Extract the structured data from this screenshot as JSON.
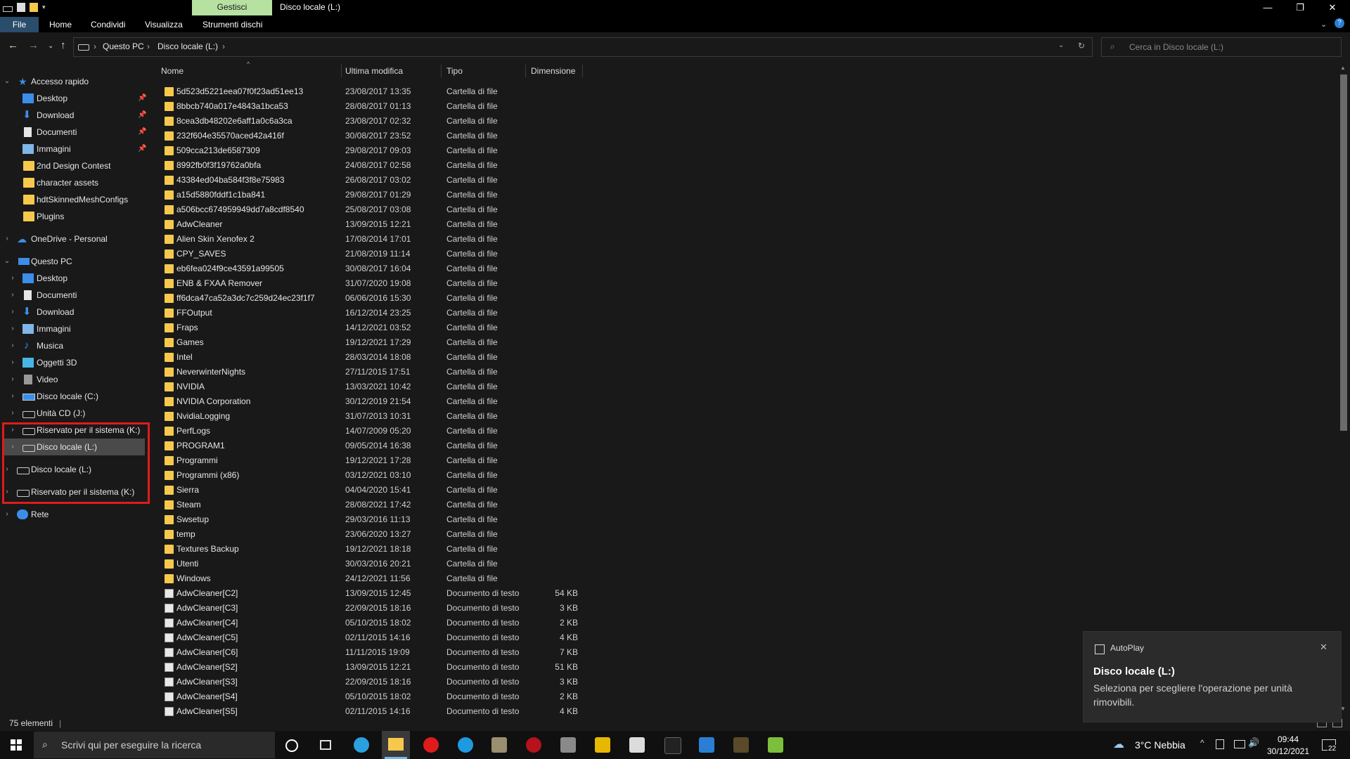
{
  "window": {
    "context_tab": "Gestisci",
    "title": "Disco locale (L:)",
    "minimize": "—",
    "maximize": "❐",
    "close": "✕"
  },
  "ribbon": {
    "tabs": [
      "File",
      "Home",
      "Condividi",
      "Visualizza",
      "Strumenti dischi"
    ]
  },
  "address": {
    "crumbs": [
      "Questo PC",
      "Disco locale (L:)"
    ],
    "search_placeholder": "Cerca in Disco locale (L:)"
  },
  "sidebar": {
    "quick_access": "Accesso rapido",
    "quick_items": [
      {
        "label": "Desktop",
        "icon": "desktop-icon",
        "pinned": true
      },
      {
        "label": "Download",
        "icon": "download-icon",
        "pinned": true
      },
      {
        "label": "Documenti",
        "icon": "documents-icon",
        "pinned": true
      },
      {
        "label": "Immagini",
        "icon": "pictures-icon",
        "pinned": true
      },
      {
        "label": "2nd Design Contest",
        "icon": "folder-icon",
        "pinned": false
      },
      {
        "label": "character assets",
        "icon": "folder-icon",
        "pinned": false
      },
      {
        "label": "hdtSkinnedMeshConfigs",
        "icon": "folder-icon",
        "pinned": false
      },
      {
        "label": "Plugins",
        "icon": "folder-icon",
        "pinned": false
      }
    ],
    "onedrive": "OneDrive - Personal",
    "this_pc": "Questo PC",
    "pc_items": [
      {
        "label": "Desktop",
        "icon": "desktop-icon"
      },
      {
        "label": "Documenti",
        "icon": "documents-icon"
      },
      {
        "label": "Download",
        "icon": "download-icon"
      },
      {
        "label": "Immagini",
        "icon": "pictures-icon"
      },
      {
        "label": "Musica",
        "icon": "music-icon"
      },
      {
        "label": "Oggetti 3D",
        "icon": "objects-3d-icon"
      },
      {
        "label": "Video",
        "icon": "video-icon"
      },
      {
        "label": "Disco locale (C:)",
        "icon": "drive-icon"
      },
      {
        "label": "Unità CD (J:)",
        "icon": "cd-drive-icon"
      },
      {
        "label": "Riservato per il sistema (K:)",
        "icon": "drive-icon"
      },
      {
        "label": "Disco locale (L:)",
        "icon": "drive-icon"
      }
    ],
    "root_drives": [
      {
        "label": "Disco locale (L:)",
        "icon": "drive-icon"
      },
      {
        "label": "Riservato per il sistema (K:)",
        "icon": "drive-icon"
      }
    ],
    "network": "Rete"
  },
  "columns": [
    "Nome",
    "Ultima modifica",
    "Tipo",
    "Dimensione"
  ],
  "files": [
    {
      "name": "5d523d5221eea07f0f23ad51ee13",
      "date": "23/08/2017 13:35",
      "type": "Cartella di file",
      "size": "",
      "kind": "folder"
    },
    {
      "name": "8bbcb740a017e4843a1bca53",
      "date": "28/08/2017 01:13",
      "type": "Cartella di file",
      "size": "",
      "kind": "folder"
    },
    {
      "name": "8cea3db48202e6aff1a0c6a3ca",
      "date": "23/08/2017 02:32",
      "type": "Cartella di file",
      "size": "",
      "kind": "folder"
    },
    {
      "name": "232f604e35570aced42a416f",
      "date": "30/08/2017 23:52",
      "type": "Cartella di file",
      "size": "",
      "kind": "folder"
    },
    {
      "name": "509cca213de6587309",
      "date": "29/08/2017 09:03",
      "type": "Cartella di file",
      "size": "",
      "kind": "folder"
    },
    {
      "name": "8992fb0f3f19762a0bfa",
      "date": "24/08/2017 02:58",
      "type": "Cartella di file",
      "size": "",
      "kind": "folder"
    },
    {
      "name": "43384ed04ba584f3f8e75983",
      "date": "26/08/2017 03:02",
      "type": "Cartella di file",
      "size": "",
      "kind": "folder"
    },
    {
      "name": "a15d5880fddf1c1ba841",
      "date": "29/08/2017 01:29",
      "type": "Cartella di file",
      "size": "",
      "kind": "folder"
    },
    {
      "name": "a506bcc674959949dd7a8cdf8540",
      "date": "25/08/2017 03:08",
      "type": "Cartella di file",
      "size": "",
      "kind": "folder"
    },
    {
      "name": "AdwCleaner",
      "date": "13/09/2015 12:21",
      "type": "Cartella di file",
      "size": "",
      "kind": "folder"
    },
    {
      "name": "Alien Skin Xenofex 2",
      "date": "17/08/2014 17:01",
      "type": "Cartella di file",
      "size": "",
      "kind": "folder"
    },
    {
      "name": "CPY_SAVES",
      "date": "21/08/2019 11:14",
      "type": "Cartella di file",
      "size": "",
      "kind": "folder"
    },
    {
      "name": "eb6fea024f9ce43591a99505",
      "date": "30/08/2017 16:04",
      "type": "Cartella di file",
      "size": "",
      "kind": "folder"
    },
    {
      "name": "ENB & FXAA Remover",
      "date": "31/07/2020 19:08",
      "type": "Cartella di file",
      "size": "",
      "kind": "folder"
    },
    {
      "name": "ff6dca47ca52a3dc7c259d24ec23f1f7",
      "date": "06/06/2016 15:30",
      "type": "Cartella di file",
      "size": "",
      "kind": "folder"
    },
    {
      "name": "FFOutput",
      "date": "16/12/2014 23:25",
      "type": "Cartella di file",
      "size": "",
      "kind": "folder"
    },
    {
      "name": "Fraps",
      "date": "14/12/2021 03:52",
      "type": "Cartella di file",
      "size": "",
      "kind": "folder"
    },
    {
      "name": "Games",
      "date": "19/12/2021 17:29",
      "type": "Cartella di file",
      "size": "",
      "kind": "folder"
    },
    {
      "name": "Intel",
      "date": "28/03/2014 18:08",
      "type": "Cartella di file",
      "size": "",
      "kind": "folder"
    },
    {
      "name": "NeverwinterNights",
      "date": "27/11/2015 17:51",
      "type": "Cartella di file",
      "size": "",
      "kind": "folder"
    },
    {
      "name": "NVIDIA",
      "date": "13/03/2021 10:42",
      "type": "Cartella di file",
      "size": "",
      "kind": "folder"
    },
    {
      "name": "NVIDIA Corporation",
      "date": "30/12/2019 21:54",
      "type": "Cartella di file",
      "size": "",
      "kind": "folder"
    },
    {
      "name": "NvidiaLogging",
      "date": "31/07/2013 10:31",
      "type": "Cartella di file",
      "size": "",
      "kind": "folder"
    },
    {
      "name": "PerfLogs",
      "date": "14/07/2009 05:20",
      "type": "Cartella di file",
      "size": "",
      "kind": "folder"
    },
    {
      "name": "PROGRAM1",
      "date": "09/05/2014 16:38",
      "type": "Cartella di file",
      "size": "",
      "kind": "folder"
    },
    {
      "name": "Programmi",
      "date": "19/12/2021 17:28",
      "type": "Cartella di file",
      "size": "",
      "kind": "folder"
    },
    {
      "name": "Programmi (x86)",
      "date": "03/12/2021 03:10",
      "type": "Cartella di file",
      "size": "",
      "kind": "folder"
    },
    {
      "name": "Sierra",
      "date": "04/04/2020 15:41",
      "type": "Cartella di file",
      "size": "",
      "kind": "folder"
    },
    {
      "name": "Steam",
      "date": "28/08/2021 17:42",
      "type": "Cartella di file",
      "size": "",
      "kind": "folder"
    },
    {
      "name": "Swsetup",
      "date": "29/03/2016 11:13",
      "type": "Cartella di file",
      "size": "",
      "kind": "folder"
    },
    {
      "name": "temp",
      "date": "23/06/2020 13:27",
      "type": "Cartella di file",
      "size": "",
      "kind": "folder"
    },
    {
      "name": "Textures Backup",
      "date": "19/12/2021 18:18",
      "type": "Cartella di file",
      "size": "",
      "kind": "folder"
    },
    {
      "name": "Utenti",
      "date": "30/03/2016 20:21",
      "type": "Cartella di file",
      "size": "",
      "kind": "folder"
    },
    {
      "name": "Windows",
      "date": "24/12/2021 11:56",
      "type": "Cartella di file",
      "size": "",
      "kind": "folder"
    },
    {
      "name": "AdwCleaner[C2]",
      "date": "13/09/2015 12:45",
      "type": "Documento di testo",
      "size": "54 KB",
      "kind": "doc"
    },
    {
      "name": "AdwCleaner[C3]",
      "date": "22/09/2015 18:16",
      "type": "Documento di testo",
      "size": "3 KB",
      "kind": "doc"
    },
    {
      "name": "AdwCleaner[C4]",
      "date": "05/10/2015 18:02",
      "type": "Documento di testo",
      "size": "2 KB",
      "kind": "doc"
    },
    {
      "name": "AdwCleaner[C5]",
      "date": "02/11/2015 14:16",
      "type": "Documento di testo",
      "size": "4 KB",
      "kind": "doc"
    },
    {
      "name": "AdwCleaner[C6]",
      "date": "11/11/2015 19:09",
      "type": "Documento di testo",
      "size": "7 KB",
      "kind": "doc"
    },
    {
      "name": "AdwCleaner[S2]",
      "date": "13/09/2015 12:21",
      "type": "Documento di testo",
      "size": "51 KB",
      "kind": "doc"
    },
    {
      "name": "AdwCleaner[S3]",
      "date": "22/09/2015 18:16",
      "type": "Documento di testo",
      "size": "3 KB",
      "kind": "doc"
    },
    {
      "name": "AdwCleaner[S4]",
      "date": "05/10/2015 18:02",
      "type": "Documento di testo",
      "size": "2 KB",
      "kind": "doc"
    },
    {
      "name": "AdwCleaner[S5]",
      "date": "02/11/2015 14:16",
      "type": "Documento di testo",
      "size": "4 KB",
      "kind": "doc"
    }
  ],
  "status": {
    "count": "75 elementi"
  },
  "toast": {
    "app": "AutoPlay",
    "title": "Disco locale (L:)",
    "body": "Seleziona per scegliere l'operazione per unità rimovibili."
  },
  "taskbar": {
    "search_placeholder": "Scrivi qui per eseguire la ricerca",
    "weather": "3°C  Nebbia",
    "time": "09:44",
    "date": "30/12/2021",
    "notifications": "22"
  },
  "colors": {
    "accent": "#2b4d6c",
    "folder": "#f6c94d",
    "highlight": "#e01b1b",
    "context_tab": "#b7e1a1"
  }
}
